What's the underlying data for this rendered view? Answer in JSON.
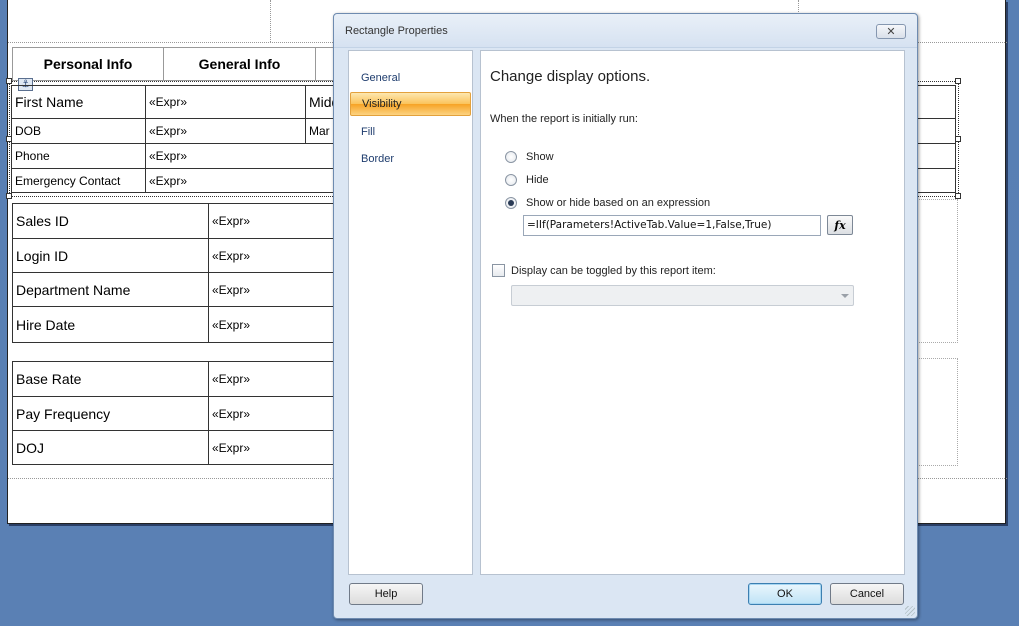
{
  "report": {
    "tabs": [
      "Personal Info",
      "General Info"
    ],
    "personal_table": [
      {
        "label": "First Name",
        "value": "«Expr»",
        "extra": "Midd"
      },
      {
        "label": "DOB",
        "value": "«Expr»",
        "extra": "Mar"
      },
      {
        "label": "Phone",
        "value": "«Expr»"
      },
      {
        "label": "Emergency Contact",
        "value": "«Expr»"
      }
    ],
    "general_table": [
      {
        "label": "Sales ID",
        "value": "«Expr»"
      },
      {
        "label": "Login ID",
        "value": "«Expr»"
      },
      {
        "label": "Department Name",
        "value": "«Expr»"
      },
      {
        "label": "Hire Date",
        "value": "«Expr»"
      }
    ],
    "pay_table": [
      {
        "label": "Base Rate",
        "value": "«Expr»"
      },
      {
        "label": "Pay Frequency",
        "value": "«Expr»"
      },
      {
        "label": "DOJ",
        "value": "«Expr»"
      }
    ]
  },
  "dialog": {
    "title": "Rectangle Properties",
    "close_glyph": "✕",
    "nav_items": [
      "General",
      "Visibility",
      "Fill",
      "Border"
    ],
    "selected_nav": "Visibility",
    "heading": "Change display options.",
    "when_label": "When the report is initially run:",
    "options": [
      "Show",
      "Hide",
      "Show or hide based on an expression"
    ],
    "selected_option": "Show or hide based on an expression",
    "expression": "=IIf(Parameters!ActiveTab.Value=1,False,True)",
    "fx_label": "fx",
    "toggle_label": "Display can be toggled by this report item:",
    "toggle_checked": false,
    "toggle_value": "",
    "help_label": "Help",
    "ok_label": "OK",
    "cancel_label": "Cancel"
  },
  "colors": {
    "desktop": "#5b7fb1",
    "dialog_bg": "#dbe6f3",
    "selected_nav": "#fbc35a"
  }
}
